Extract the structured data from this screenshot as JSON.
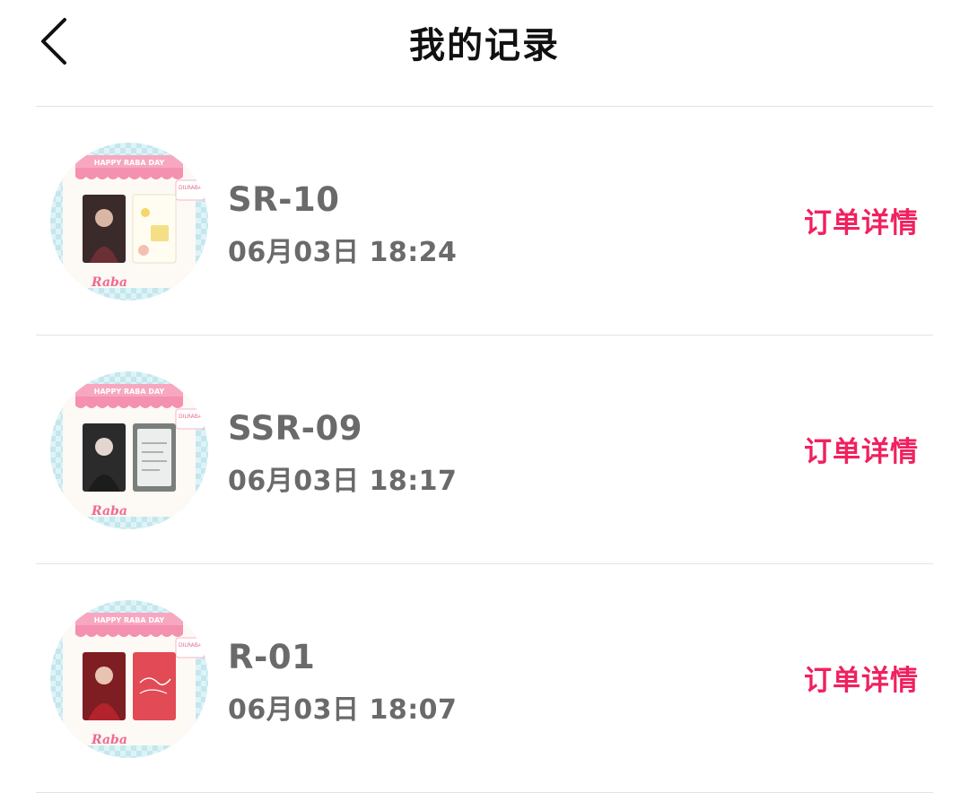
{
  "header": {
    "title": "我的记录",
    "back_icon": "chevron-left-icon"
  },
  "records": [
    {
      "code": "SR-10",
      "time": "06月03日 18:24",
      "action": "订单详情",
      "banner": "HAPPY RABA DAY",
      "brand": "DILRABA",
      "logo": "Raba",
      "card_left": "portrait-dark",
      "card_right": "doodle-yellow"
    },
    {
      "code": "SSR-09",
      "time": "06月03日 18:17",
      "action": "订单详情",
      "banner": "HAPPY RABA DAY",
      "brand": "DILRABA",
      "logo": "Raba",
      "card_left": "portrait-mono",
      "card_right": "note-gray"
    },
    {
      "code": "R-01",
      "time": "06月03日 18:07",
      "action": "订单详情",
      "banner": "HAPPY RABA DAY",
      "brand": "DILRABA",
      "logo": "Raba",
      "card_left": "portrait-red",
      "card_right": "card-red"
    }
  ],
  "colors": {
    "accent": "#f0215f",
    "text_secondary": "#6a6a6a",
    "divider": "#e3e3e3"
  }
}
